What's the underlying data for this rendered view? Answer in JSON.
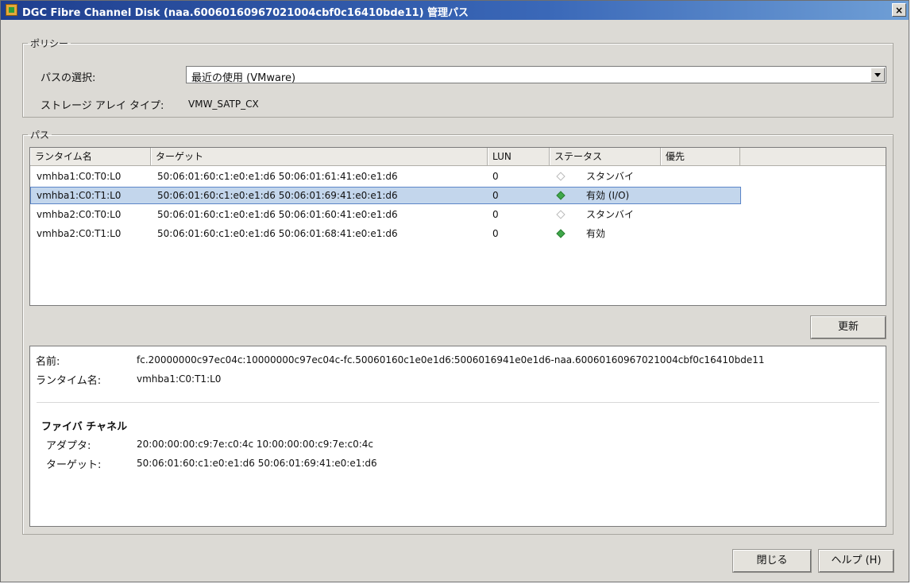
{
  "window": {
    "title": "DGC Fibre Channel Disk (naa.60060160967021004cbf0c16410bde11) 管理パス",
    "close_glyph": "×"
  },
  "policy": {
    "legend": "ポリシー",
    "path_select_label": "パスの選択:",
    "path_select_value": "最近の使用 (VMware)",
    "storage_array_type_label": "ストレージ アレイ タイプ:",
    "storage_array_type_value": "VMW_SATP_CX"
  },
  "paths": {
    "legend": "パス",
    "columns": [
      "ランタイム名",
      "ターゲット",
      "LUN",
      "ステータス",
      "優先"
    ],
    "rows": [
      {
        "runtime": "vmhba1:C0:T0:L0",
        "target": "50:06:01:60:c1:e0:e1:d6 50:06:01:61:41:e0:e1:d6",
        "lun": "0",
        "status": "スタンバイ",
        "status_icon": "standby-diamond-icon",
        "preferred": ""
      },
      {
        "runtime": "vmhba1:C0:T1:L0",
        "target": "50:06:01:60:c1:e0:e1:d6 50:06:01:69:41:e0:e1:d6",
        "lun": "0",
        "status": "有効 (I/O)",
        "status_icon": "active-diamond-icon",
        "preferred": ""
      },
      {
        "runtime": "vmhba2:C0:T0:L0",
        "target": "50:06:01:60:c1:e0:e1:d6 50:06:01:60:41:e0:e1:d6",
        "lun": "0",
        "status": "スタンバイ",
        "status_icon": "standby-diamond-icon",
        "preferred": ""
      },
      {
        "runtime": "vmhba2:C0:T1:L0",
        "target": "50:06:01:60:c1:e0:e1:d6 50:06:01:68:41:e0:e1:d6",
        "lun": "0",
        "status": "有効",
        "status_icon": "active-diamond-icon",
        "preferred": ""
      }
    ],
    "refresh_label": "更新"
  },
  "details": {
    "name_label": "名前:",
    "name_value": "fc.20000000c97ec04c:10000000c97ec04c-fc.50060160c1e0e1d6:5006016941e0e1d6-naa.60060160967021004cbf0c16410bde11",
    "runtime_label": "ランタイム名:",
    "runtime_value": "vmhba1:C0:T1:L0",
    "fc_heading": "ファイバ チャネル",
    "adapter_label": "アダプタ:",
    "adapter_value": "20:00:00:00:c9:7e:c0:4c 10:00:00:00:c9:7e:c0:4c",
    "target_label": "ターゲット:",
    "target_value": "50:06:01:60:c1:e0:e1:d6 50:06:01:69:41:e0:e1:d6"
  },
  "footer": {
    "close_label": "閉じる",
    "help_label": "ヘルプ (H)"
  },
  "colors": {
    "active": "#3fa84a",
    "selection": "#c3d6ec",
    "titlebar": "#1f3f8f"
  }
}
